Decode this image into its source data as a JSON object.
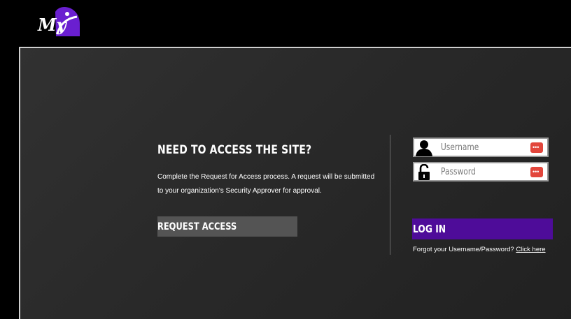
{
  "header": {
    "logo_text": "My"
  },
  "access": {
    "title": "NEED TO ACCESS THE SITE?",
    "description": "Complete the Request for Access process. A request will be submitted to your organization's Security Approver for approval.",
    "request_button": "REQUEST ACCESS"
  },
  "login": {
    "username_placeholder": "Username",
    "password_placeholder": "Password",
    "login_button": "LOG IN",
    "forgot_text": "Forgot your Username/Password?",
    "forgot_link": "Click here"
  },
  "icons": {
    "user": "user-icon",
    "lock": "lock-icon",
    "password_key": "password-key-icon"
  },
  "colors": {
    "accent": "#4e0c99",
    "logo_purple": "#6a1fd0",
    "request_button": "#545454",
    "key_icon": "#e2463c"
  }
}
